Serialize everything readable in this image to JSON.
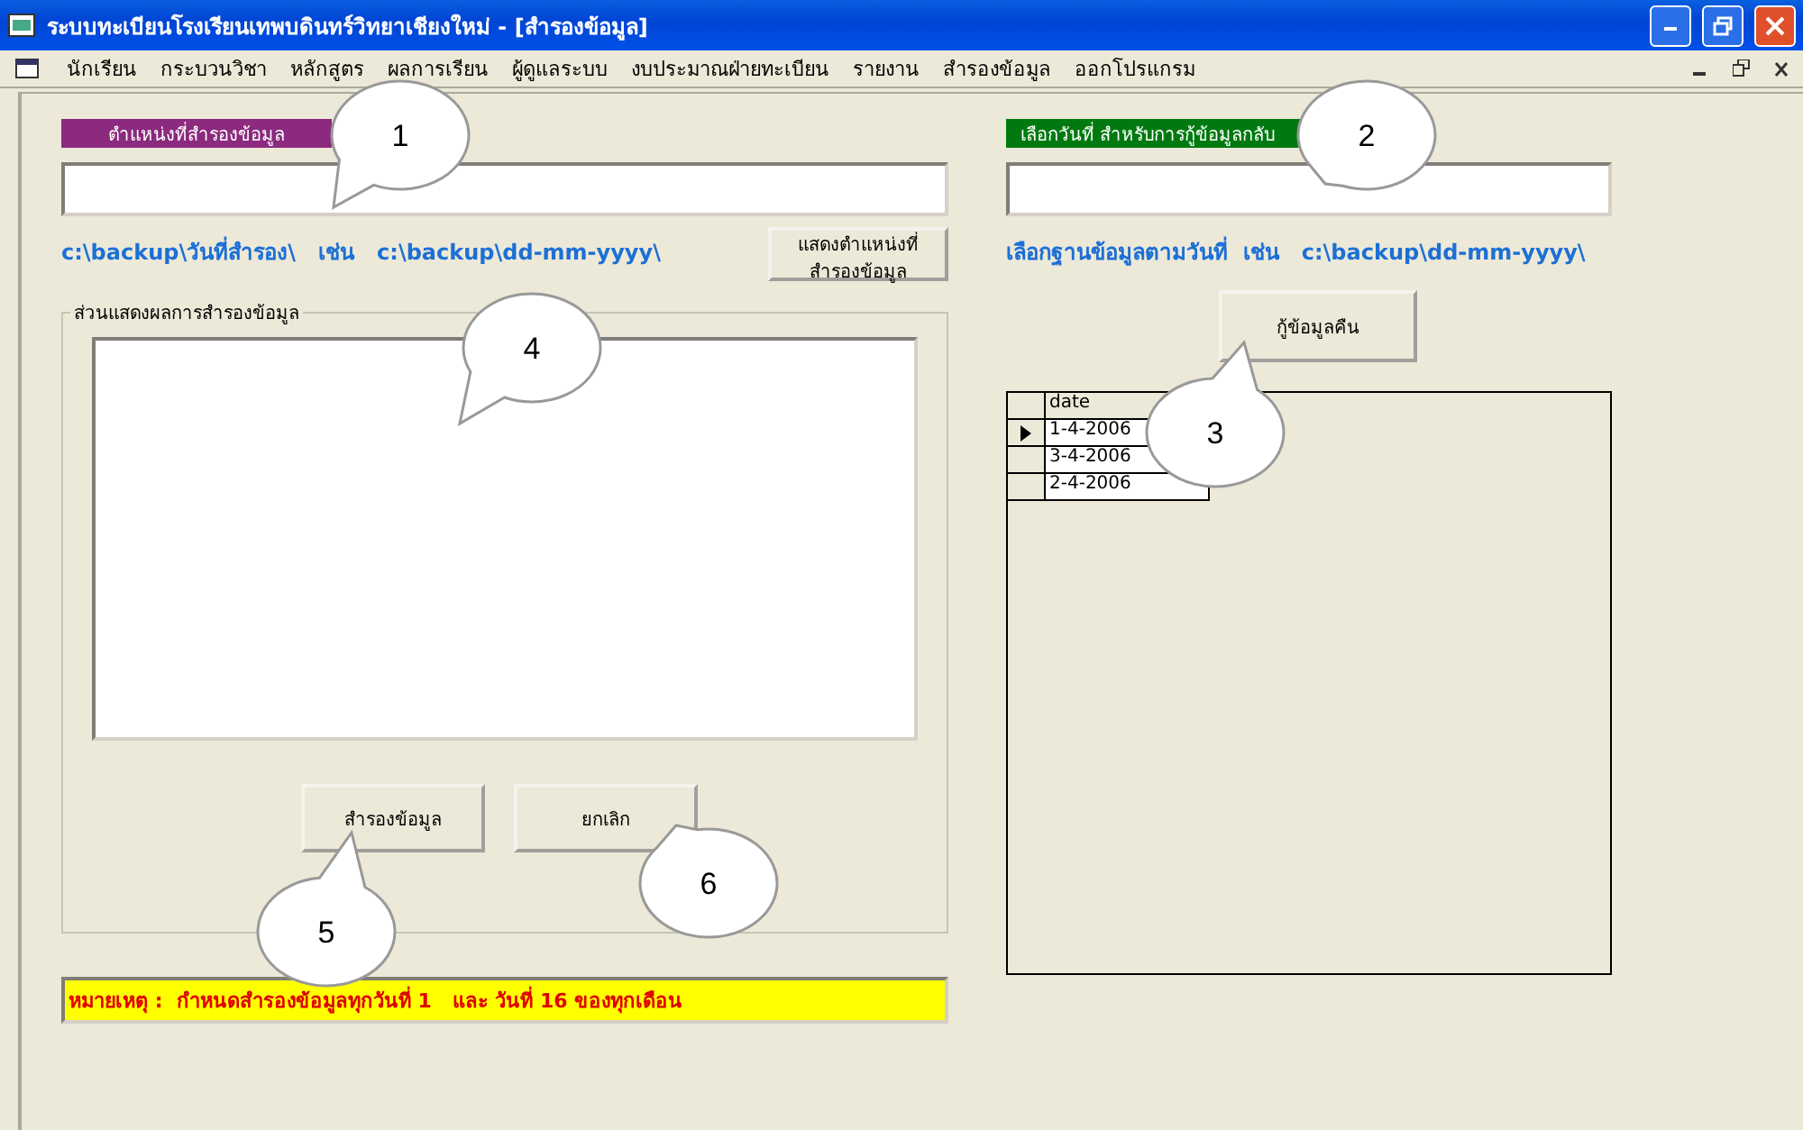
{
  "window": {
    "title": "ระบบทะเบียนโรงเรียนเทพบดินทร์วิทยาเชียงใหม่ - [สำรองข้อมูล]"
  },
  "menu": [
    "นักเรียน",
    "กระบวนวิชา",
    "หลักสูตร",
    "ผลการเรียน",
    "ผู้ดูแลระบบ",
    "งบประมาณฝ่ายทะเบียน",
    "รายงาน",
    "สำรองข้อมูล",
    "ออกโปรแกรม"
  ],
  "backup": {
    "label": "ตำแหน่งที่สำรองข้อมูล",
    "hint": "c:\\backup\\วันที่สำรอง\\   เช่น   c:\\backup\\dd-mm-yyyy\\",
    "show_button": "แสดงตำแหน่งที่\nสำรองข้อมูล",
    "group_title": "ส่วนแสดงผลการสำรองข้อมูล",
    "buttons": [
      "สำรองข้อมูล",
      "ยกเลิก"
    ],
    "note": "หมายเหตุ :  กำหนดสำรองข้อมูลทุกวันที่ 1   และ วันที่ 16 ของทุกเดือน"
  },
  "restore": {
    "label": "เลือกวันที่ สำหรับการกู้ข้อมูลกลับ",
    "hint": "เลือกฐานข้อมูลตามวันที่  เช่น   c:\\backup\\dd-mm-yyyy\\",
    "button": "กู้ข้อมูลคืน",
    "table": {
      "columns": [
        "date"
      ],
      "rows": [
        {
          "date": "1-4-2006",
          "selected": true
        },
        {
          "date": "3-4-2006",
          "selected": false
        },
        {
          "date": "2-4-2006",
          "selected": false
        }
      ]
    }
  },
  "callouts": [
    "1",
    "2",
    "3",
    "4",
    "5",
    "6"
  ]
}
